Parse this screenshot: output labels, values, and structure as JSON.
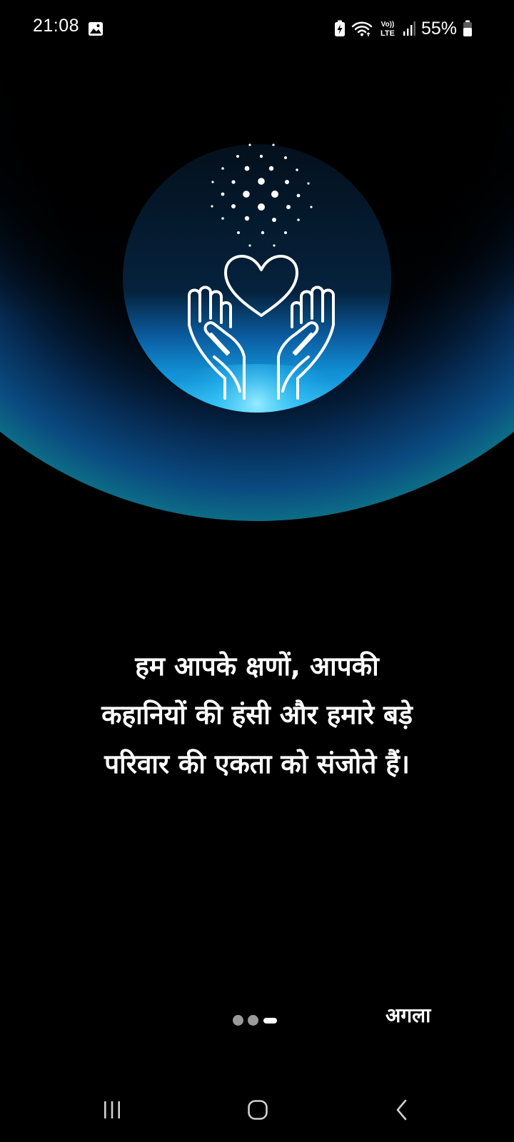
{
  "status_bar": {
    "time": "21:08",
    "battery_percent": "55%",
    "network_label": "Vo)) LTE",
    "icons": [
      "gallery-icon",
      "battery-saver-icon",
      "wifi-icon",
      "volte-icon",
      "signal-icon",
      "battery-icon"
    ]
  },
  "hero": {
    "icon": "hands-holding-heart-icon",
    "colors": {
      "background": "#000000",
      "glow": "#1fb0f0",
      "line": "#ffffff"
    }
  },
  "onboarding": {
    "message": "हम आपके क्षणों, आपकी\nकहानियों की हंसी और हमारे बड़े\nपरिवार की एकता को संजोते हैं।",
    "page_indicator": {
      "total": 3,
      "current": 3
    },
    "next_label": "अगला"
  },
  "nav_bar": {
    "buttons": [
      "recent-apps-icon",
      "home-icon",
      "back-icon"
    ]
  }
}
